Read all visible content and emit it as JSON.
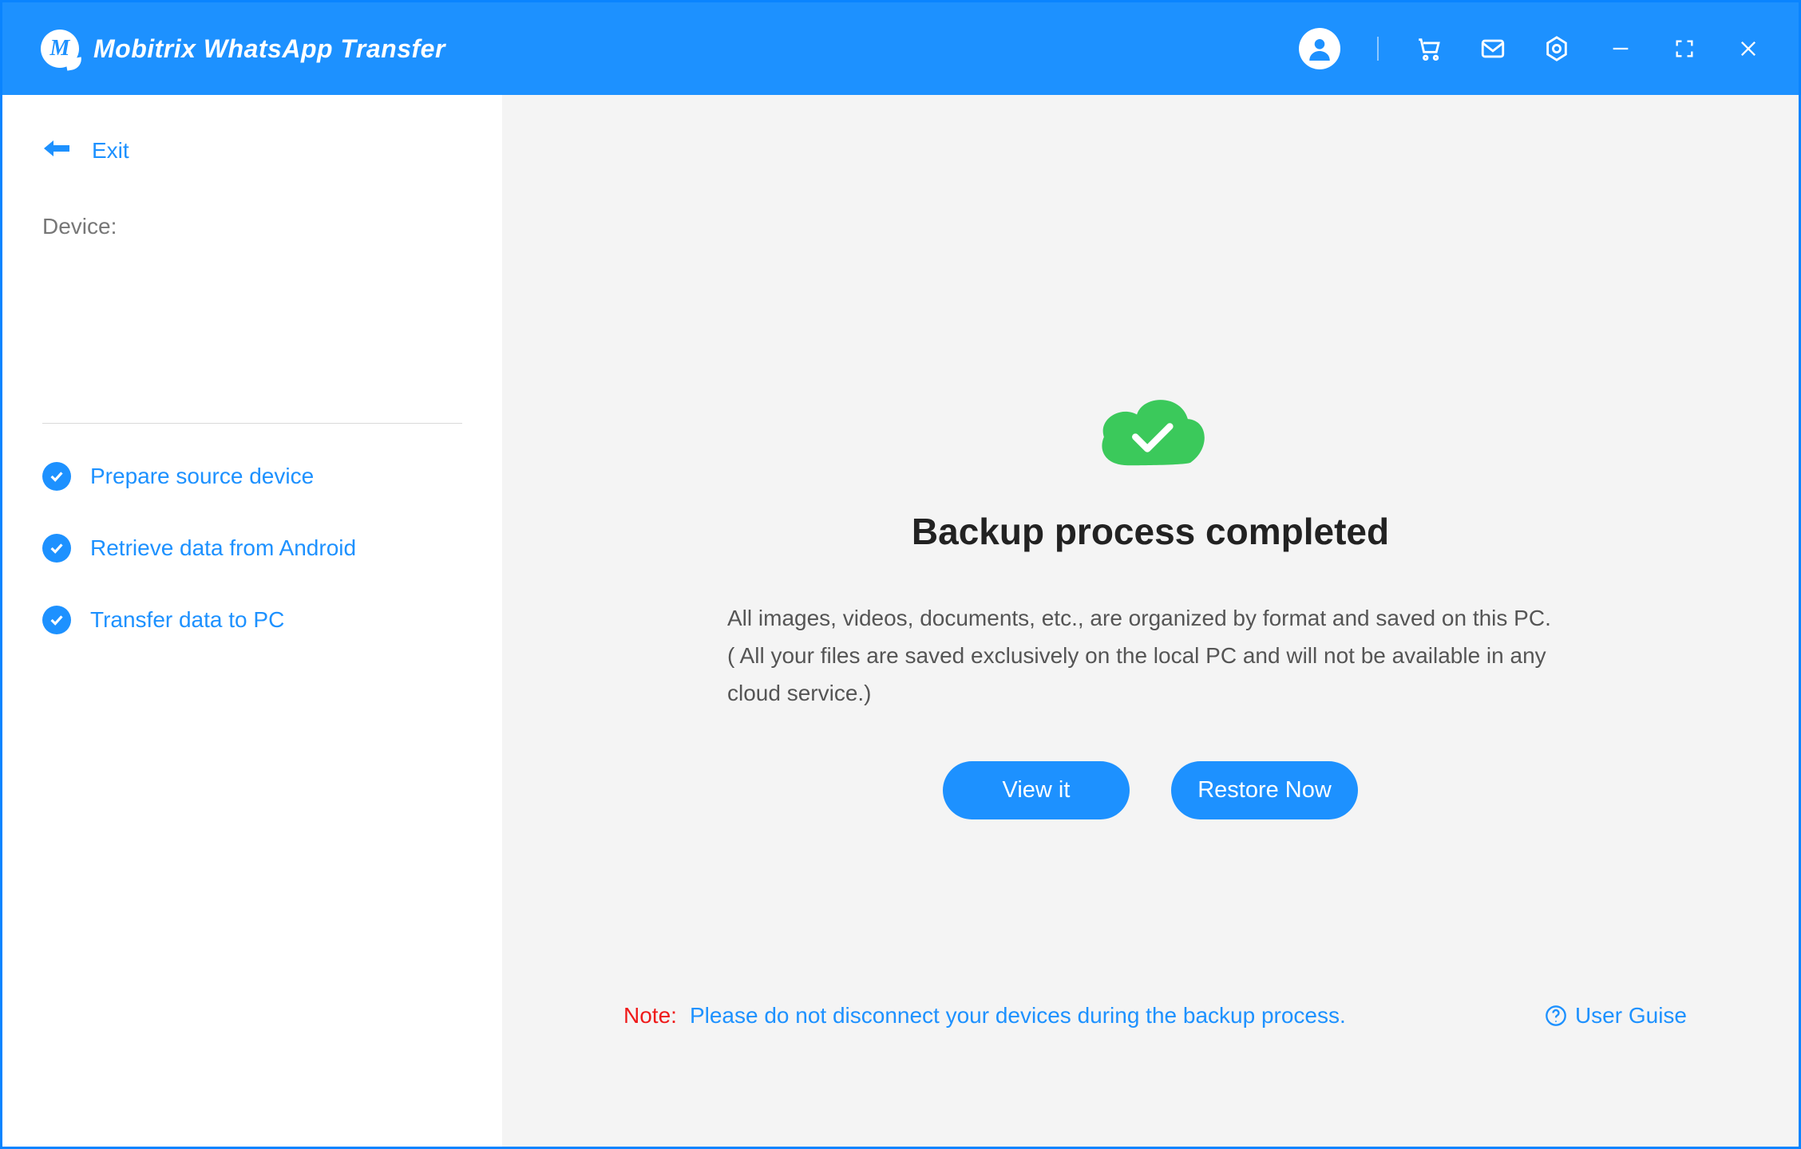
{
  "header": {
    "title": "Mobitrix WhatsApp Transfer",
    "logo_letter": "M"
  },
  "sidebar": {
    "exit_label": "Exit",
    "device_label": "Device:",
    "steps": [
      {
        "label": "Prepare source device"
      },
      {
        "label": "Retrieve data from Android"
      },
      {
        "label": "Transfer data to PC"
      }
    ]
  },
  "main": {
    "title": "Backup process completed",
    "description1": "All images, videos, documents, etc., are organized by format and saved on this PC.",
    "description2": "( All your files are saved exclusively on the local PC and will not be available in any cloud service.)",
    "view_btn": "View it",
    "restore_btn": "Restore Now"
  },
  "footer": {
    "note_label": "Note:",
    "note_text": "Please do not disconnect your devices during the backup process.",
    "guide_link": "User Guise"
  }
}
